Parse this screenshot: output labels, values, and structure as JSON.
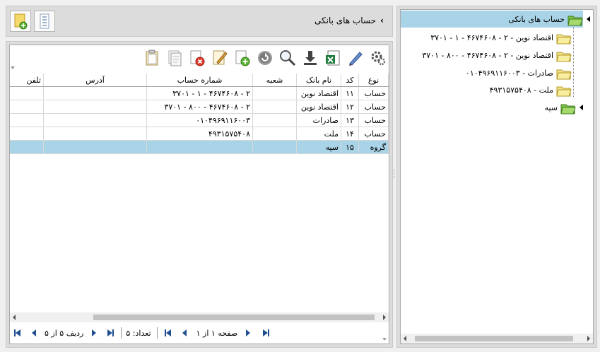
{
  "header": {
    "title": "حساب های بانکی"
  },
  "toolbar": {
    "icons": [
      "paste-icon",
      "copy-icon",
      "delete-icon",
      "edit-icon",
      "add-icon",
      "refresh-icon",
      "search-icon",
      "download-icon",
      "excel-icon",
      "pen-icon",
      "settings-icon"
    ]
  },
  "grid": {
    "columns": [
      "نوع",
      "کد",
      "نام بانک",
      "شعبه",
      "شماره حساب",
      "آدرس",
      "تلفن"
    ],
    "rows": [
      {
        "type": "حساب",
        "code": "۱۱",
        "bank": "اقتصاد نوین",
        "branch": "",
        "account": "۲ - ۴۶۷۴۶۰۸ - ۱ - ۳۷۰۱",
        "address": "",
        "phone": ""
      },
      {
        "type": "حساب",
        "code": "۱۲",
        "bank": "اقتصاد نوین",
        "branch": "",
        "account": "۲ - ۴۶۷۴۶۰۸ - ۸۰۰ - ۳۷۰۱",
        "address": "",
        "phone": ""
      },
      {
        "type": "حساب",
        "code": "۱۳",
        "bank": "صادرات",
        "branch": "",
        "account": "۰۱۰۴۹۶۹۱۱۶۰۰۳",
        "address": "",
        "phone": ""
      },
      {
        "type": "حساب",
        "code": "۱۴",
        "bank": "ملت",
        "branch": "",
        "account": "۴۹۳۱۵۷۵۴۰۸",
        "address": "",
        "phone": ""
      },
      {
        "type": "گروه",
        "code": "۱۵",
        "bank": "سپه",
        "branch": "",
        "account": "",
        "address": "",
        "phone": ""
      }
    ]
  },
  "pager": {
    "page_text": "صفحه ۱ از ۱",
    "count_text": "تعداد: ۵",
    "row_text": "ردیف ۵ از ۵"
  },
  "tree": {
    "root": "حساب های بانکی",
    "children": [
      "اقتصاد نوین - ۲ - ۴۶۷۴۶۰۸ - ۱ - ۳۷۰۱",
      "اقتصاد نوین - ۲ - ۴۶۷۴۶۰۸ - ۸۰۰ - ۳۷۰۱",
      "صادرات - ۰۱۰۴۹۶۹۱۱۶۰۰۳",
      "ملت - ۴۹۳۱۵۷۵۴۰۸",
      "سپه"
    ]
  },
  "colors": {
    "selection": "#a9d3e6",
    "tree_root_bg": "#a9d3e6",
    "folder": "#f3e38a",
    "green": "#7cc04a"
  }
}
